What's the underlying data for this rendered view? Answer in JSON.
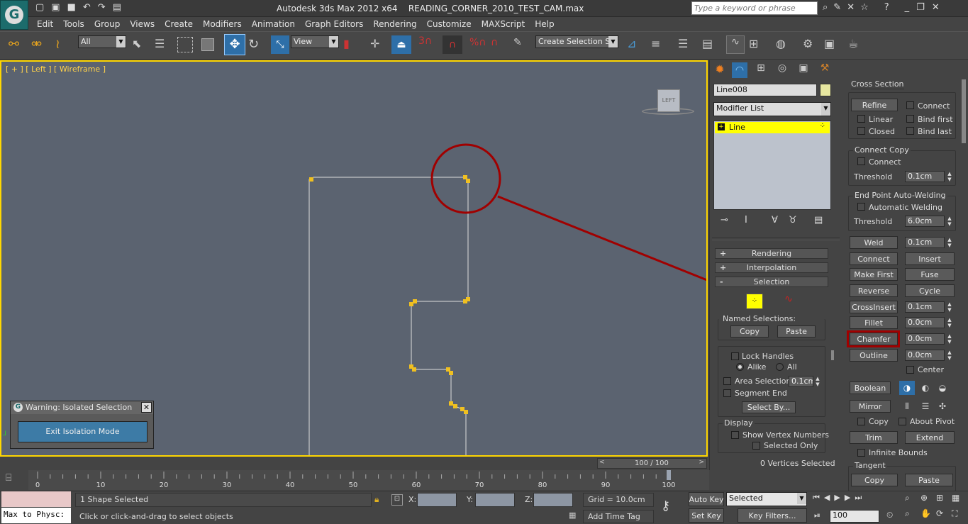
{
  "app": {
    "title": "Autodesk 3ds Max  2012 x64",
    "file": "READING_CORNER_2010_TEST_CAM.max",
    "search_placeholder": "Type a keyword or phrase"
  },
  "menu": [
    "Edit",
    "Tools",
    "Group",
    "Views",
    "Create",
    "Modifiers",
    "Animation",
    "Graph Editors",
    "Rendering",
    "Customize",
    "MAXScript",
    "Help"
  ],
  "toolbar": {
    "filter_value": "All",
    "ref_coord_value": "View",
    "selection_set_value": "Create Selection Se",
    "snap_num": "3"
  },
  "viewport": {
    "label": "[ + ] [ Left ] [ Wireframe ]",
    "viewcube": "LEFT",
    "scroll_value": "100 / 100",
    "isolation_title": "Warning: Isolated Selection",
    "isolation_button": "Exit Isolation Mode"
  },
  "timeline": {
    "ticks": [
      "0",
      "10",
      "20",
      "30",
      "40",
      "50",
      "60",
      "70",
      "80",
      "90",
      "100"
    ]
  },
  "status": {
    "script_label": "Max to Physc:",
    "selected": "1 Shape Selected",
    "prompt": "Click or click-and-drag to select objects",
    "x_label": "X:",
    "y_label": "Y:",
    "z_label": "Z:",
    "grid": "Grid = 10.0cm",
    "add_time_tag": "Add Time Tag",
    "auto_key": "Auto Key",
    "set_key": "Set Key",
    "key_mode": "Selected",
    "key_filters": "Key Filters...",
    "frame": "100"
  },
  "command_panel": {
    "object_name": "Line008",
    "object_color": "#e6e6a0",
    "modifier_list": "Modifier List",
    "stack_item": "Line",
    "rollouts": {
      "rendering": "Rendering",
      "interpolation": "Interpolation",
      "selection": "Selection"
    },
    "named_selections": "Named Selections:",
    "copy": "Copy",
    "paste": "Paste",
    "lock_handles": "Lock Handles",
    "alike": "Alike",
    "all": "All",
    "area_selection": "Area Selection:",
    "area_value": "0.1cm",
    "segment_end": "Segment End",
    "select_by": "Select By...",
    "display": "Display",
    "show_vertex_numbers": "Show Vertex Numbers",
    "selected_only": "Selected Only",
    "vertices_selected": "0 Vertices Selected"
  },
  "geometry": {
    "cross_section": "Cross Section",
    "refine": "Refine",
    "connect": "Connect",
    "linear": "Linear",
    "bind_first": "Bind first",
    "closed": "Closed",
    "bind_last": "Bind last",
    "connect_copy": "Connect Copy",
    "connect_cb": "Connect",
    "threshold": "Threshold",
    "threshold_value": "0.1cm",
    "end_point_welding": "End Point Auto-Welding",
    "automatic_welding": "Automatic Welding",
    "threshold2_value": "6.0cm",
    "weld": "Weld",
    "weld_value": "0.1cm",
    "connect_btn": "Connect",
    "insert": "Insert",
    "make_first": "Make First",
    "fuse": "Fuse",
    "reverse": "Reverse",
    "cycle": "Cycle",
    "crossinsert": "CrossInsert",
    "crossinsert_value": "0.1cm",
    "fillet": "Fillet",
    "fillet_value": "0.0cm",
    "chamfer": "Chamfer",
    "chamfer_value": "0.0cm",
    "outline": "Outline",
    "outline_value": "0.0cm",
    "center": "Center",
    "boolean": "Boolean",
    "mirror": "Mirror",
    "copy": "Copy",
    "about_pivot": "About Pivot",
    "trim": "Trim",
    "extend": "Extend",
    "infinite_bounds": "Infinite Bounds",
    "tangent": "Tangent",
    "tangent_copy": "Copy",
    "tangent_paste": "Paste"
  },
  "colors": {
    "viewport_bg": "#5b6370",
    "active_border": "#ffd700",
    "selection_yellow": "#ffff00",
    "annotation_red": "#a00000",
    "vertex": "#f0c020"
  }
}
